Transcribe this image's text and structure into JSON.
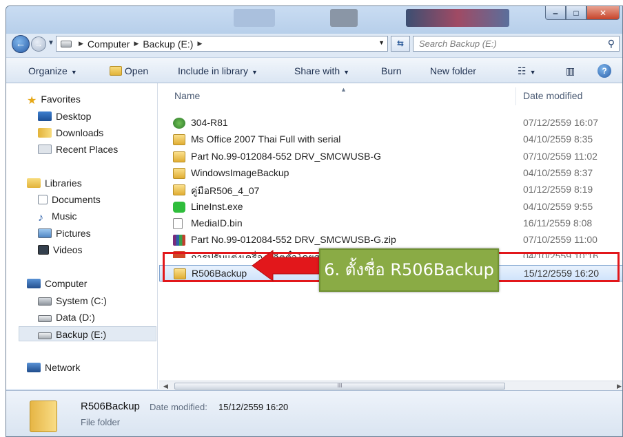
{
  "window": {
    "controls": {
      "minimize": "‒",
      "maximize": "□",
      "close": "✕"
    }
  },
  "nav": {
    "breadcrumbs": [
      "Computer",
      "Backup (E:)"
    ],
    "search_placeholder": "Search Backup (E:)"
  },
  "toolbar": {
    "organize": "Organize",
    "open": "Open",
    "include_in_library": "Include in library",
    "share_with": "Share with",
    "burn": "Burn",
    "new_folder": "New folder"
  },
  "sidebar": {
    "favorites": "Favorites",
    "favorites_items": [
      "Desktop",
      "Downloads",
      "Recent Places"
    ],
    "libraries": "Libraries",
    "libraries_items": [
      "Documents",
      "Music",
      "Pictures",
      "Videos"
    ],
    "computer": "Computer",
    "computer_items": [
      "System (C:)",
      "Data (D:)",
      "Backup (E:)"
    ],
    "network": "Network"
  },
  "filelist": {
    "columns": {
      "name": "Name",
      "date_modified": "Date modified"
    },
    "rows": [
      {
        "name": "304-R81",
        "date": "07/12/2559 16:07",
        "icon": "network-shortcut-icon"
      },
      {
        "name": "Ms Office 2007 Thai Full with serial",
        "date": "04/10/2559 8:35",
        "icon": "folder-icon"
      },
      {
        "name": "Part No.99-012084-552 DRV_SMCWUSB-G",
        "date": "07/10/2559 11:02",
        "icon": "folder-icon"
      },
      {
        "name": "WindowsImageBackup",
        "date": "04/10/2559 8:37",
        "icon": "folder-icon"
      },
      {
        "name": "คู่มือR506_4_07",
        "date": "01/12/2559 8:19",
        "icon": "folder-icon"
      },
      {
        "name": "LineInst.exe",
        "date": "04/10/2559 9:55",
        "icon": "line-app-icon"
      },
      {
        "name": "MediaID.bin",
        "date": "16/11/2559 8:08",
        "icon": "bin-file-icon"
      },
      {
        "name": "Part No.99-012084-552 DRV_SMCWUSB-G.zip",
        "date": "07/10/2559 11:00",
        "icon": "winrar-archive-icon"
      },
      {
        "name": "การปรับแต่งเครื่องผลิตตั๋วโดยสาร",
        "date": "04/10/2559 10:16",
        "icon": "powerpoint-file-icon"
      },
      {
        "name": "R506Backup",
        "date": "15/12/2559 16:20",
        "icon": "folder-icon"
      }
    ],
    "scroll_grip": "III"
  },
  "details": {
    "name": "R506Backup",
    "date_label": "Date modified:",
    "date_value": "15/12/2559 16:20",
    "type": "File folder"
  },
  "annotation": {
    "text": "6. ตั้งชื่อ R506Backup",
    "color": "#e2171b",
    "callout_color": "#8aab45"
  }
}
